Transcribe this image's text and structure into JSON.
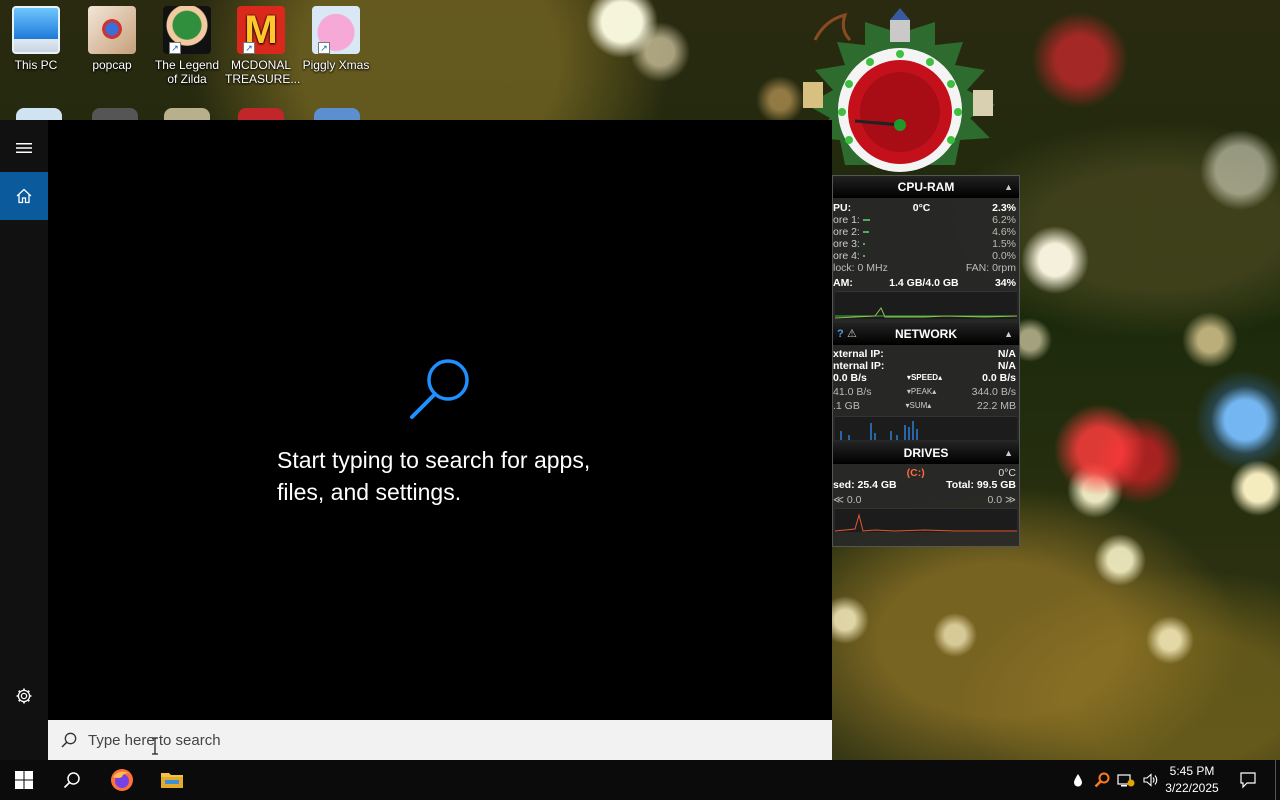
{
  "desktop": {
    "icons": [
      {
        "label": "This PC",
        "icon": "this-pc-icon"
      },
      {
        "label": "popcap",
        "icon": "popcap-icon"
      },
      {
        "label": "The Legend of Zilda",
        "icon": "zelda-game-icon"
      },
      {
        "label": "MCDONAL TREASURE...",
        "icon": "mcdonalds-icon"
      },
      {
        "label": "Piggly Xmas",
        "icon": "piggly-xmas-icon"
      }
    ]
  },
  "start_menu": {
    "rail": {
      "menu_icon": "hamburger-icon",
      "home_icon": "home-icon",
      "settings_icon": "gear-icon"
    },
    "hero_text": "Start typing to search for apps, files, and settings.",
    "search": {
      "placeholder": "Type here to search",
      "value": ""
    }
  },
  "sys_monitor": {
    "cpu_ram": {
      "title": "CPU-RAM",
      "cpu_label": "PU:",
      "cpu_temp": "0°C",
      "cpu_pct": "2.3%",
      "cores": [
        {
          "label": "ore 1:",
          "pct": "6.2%",
          "fill": 0.062
        },
        {
          "label": "ore 2:",
          "pct": "4.6%",
          "fill": 0.046
        },
        {
          "label": "ore 3:",
          "pct": "1.5%",
          "fill": 0.015
        },
        {
          "label": "ore 4:",
          "pct": "0.0%",
          "fill": 0.0
        }
      ],
      "clock": "lock: 0 MHz",
      "fan": "FAN: 0rpm",
      "ram_label": "AM:",
      "ram_value": "1.4 GB/4.0 GB",
      "ram_pct": "34%"
    },
    "network": {
      "title": "NETWORK",
      "external_ip_label": "xternal IP:",
      "external_ip": "N/A",
      "internal_ip_label": "nternal IP:",
      "internal_ip": "N/A",
      "speed_left": "0.0 B/s",
      "speed_tag": "SPEED",
      "speed_right": "0.0 B/s",
      "peak_left": "41.0 B/s",
      "peak_tag": "PEAK",
      "peak_right": "344.0 B/s",
      "sum_left": ".1 GB",
      "sum_tag": "SUM",
      "sum_right": "22.2 MB"
    },
    "drives": {
      "title": "DRIVES",
      "drive": "(C:)",
      "temp": "0°C",
      "used": "sed: 25.4 GB",
      "total": "Total: 99.5 GB",
      "read": "0.0",
      "write": "0.0"
    }
  },
  "taskbar": {
    "start_icon": "windows-logo-icon",
    "search_icon": "search-icon",
    "apps": [
      "firefox-icon",
      "file-explorer-icon"
    ],
    "tray_icons": [
      "drop-icon",
      "search-tray-icon",
      "network-icon",
      "volume-icon"
    ],
    "time": "5:45 PM",
    "date": "3/22/2025",
    "notification_icon": "notification-icon"
  },
  "colors": {
    "accent": "#0a5a9c",
    "start_bg": "#000000",
    "rail_bg": "#111111",
    "search_bg": "#f2f2f2",
    "taskbar_bg": "#0b0b0b"
  }
}
